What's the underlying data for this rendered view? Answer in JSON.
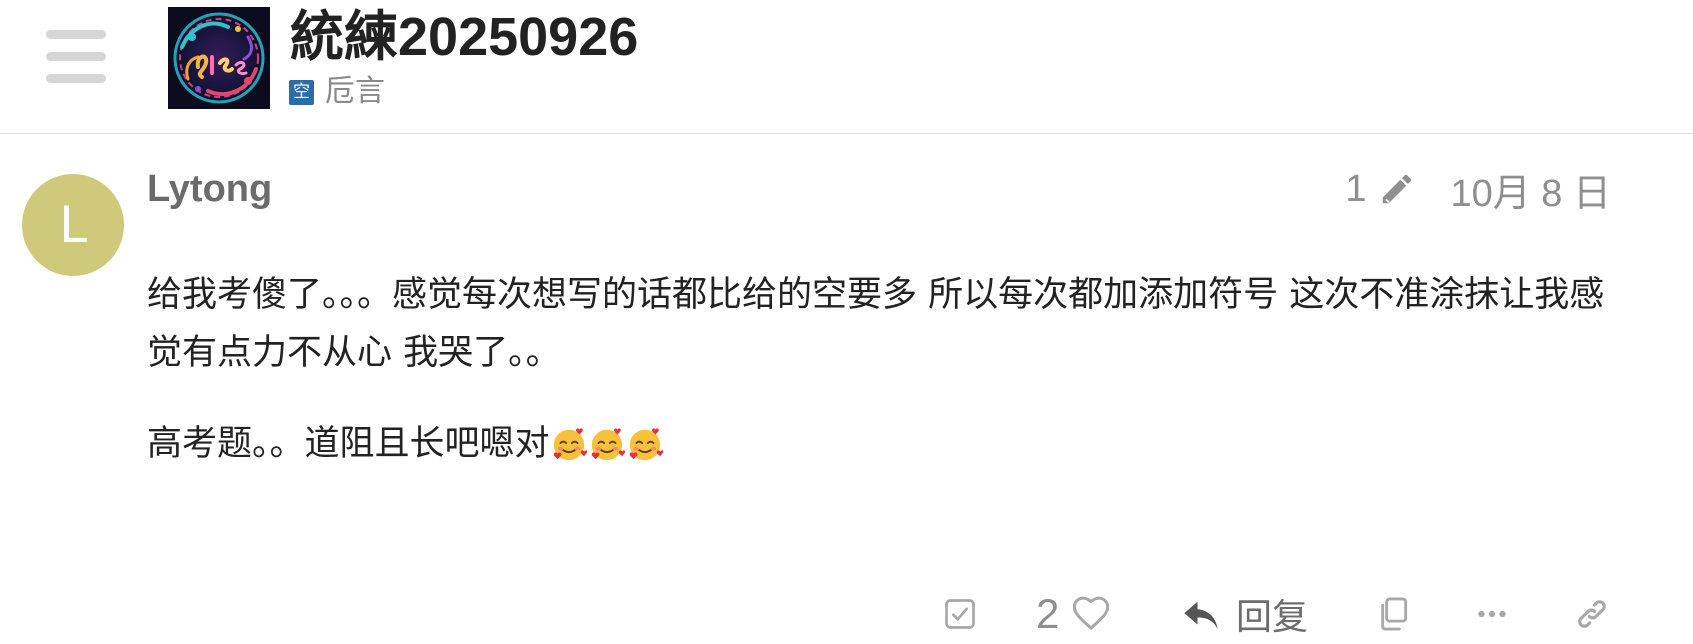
{
  "header": {
    "menu_icon": "hamburger-menu-icon",
    "topic_title": "統練20250926",
    "category": {
      "badge": "空",
      "name": "卮言",
      "badge_color": "#2c6ca8"
    }
  },
  "post": {
    "avatar_letter": "L",
    "avatar_color": "#cfc97c",
    "username": "Lytong",
    "edit_count": "1",
    "date": "10月 8 日",
    "paragraphs": [
      "给我考傻了。。。感觉每次想写的话都比给的空要多 所以每次都加添加符号 这次不准涂抹让我感觉有点力不从心 我哭了。。",
      "高考题。。道阻且长吧嗯对"
    ],
    "emoji": "smiling-face-with-hearts",
    "emoji_count": 3
  },
  "actions": {
    "like_count": "2",
    "reply_label": "回复",
    "icons": [
      "checkbox-icon",
      "heart-icon",
      "reply-icon",
      "copy-icon",
      "more-icon",
      "link-icon"
    ]
  },
  "colors": {
    "title": "#222222",
    "muted": "#8f8f8f",
    "divider": "#dcdcdc"
  }
}
